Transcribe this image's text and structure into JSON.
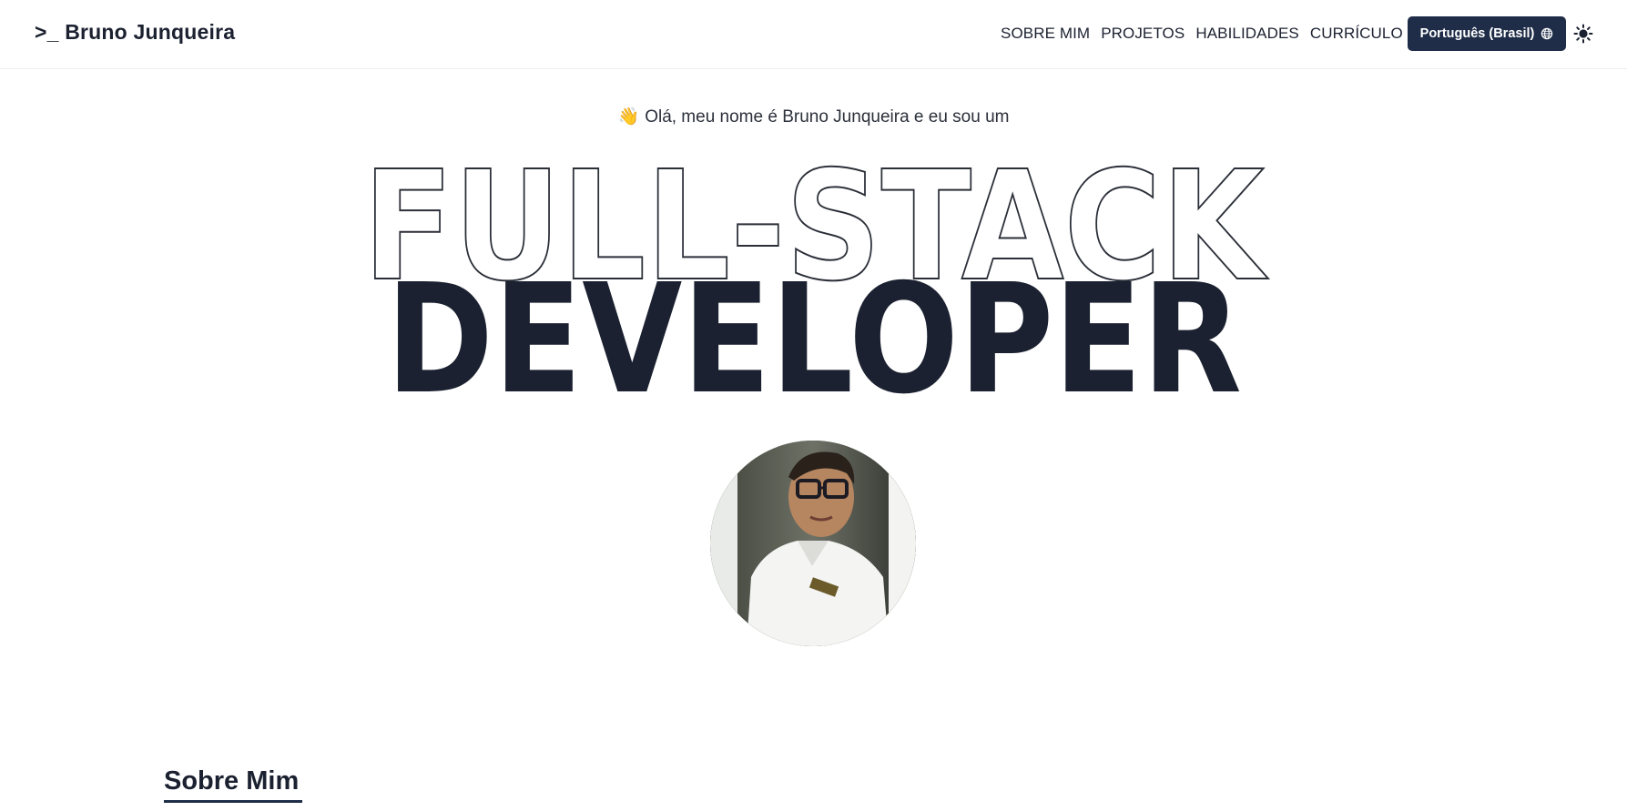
{
  "header": {
    "brand": ">_ Bruno Junqueira",
    "nav": [
      "SOBRE MIM",
      "PROJETOS",
      "HABILIDADES",
      "CURRÍCULO"
    ],
    "language_button": "Português (Brasil)",
    "language_icon": "globe-icon",
    "theme_icon": "sun-icon",
    "accent_color": "#1f2d48"
  },
  "hero": {
    "greeting_emoji": "👋",
    "greeting": "Olá, meu nome é Bruno Junqueira e eu sou um",
    "title_line1": "FULL-STACK",
    "title_line2": "DEVELOPER",
    "avatar": "profile-photo"
  },
  "about": {
    "title": "Sobre Mim"
  }
}
